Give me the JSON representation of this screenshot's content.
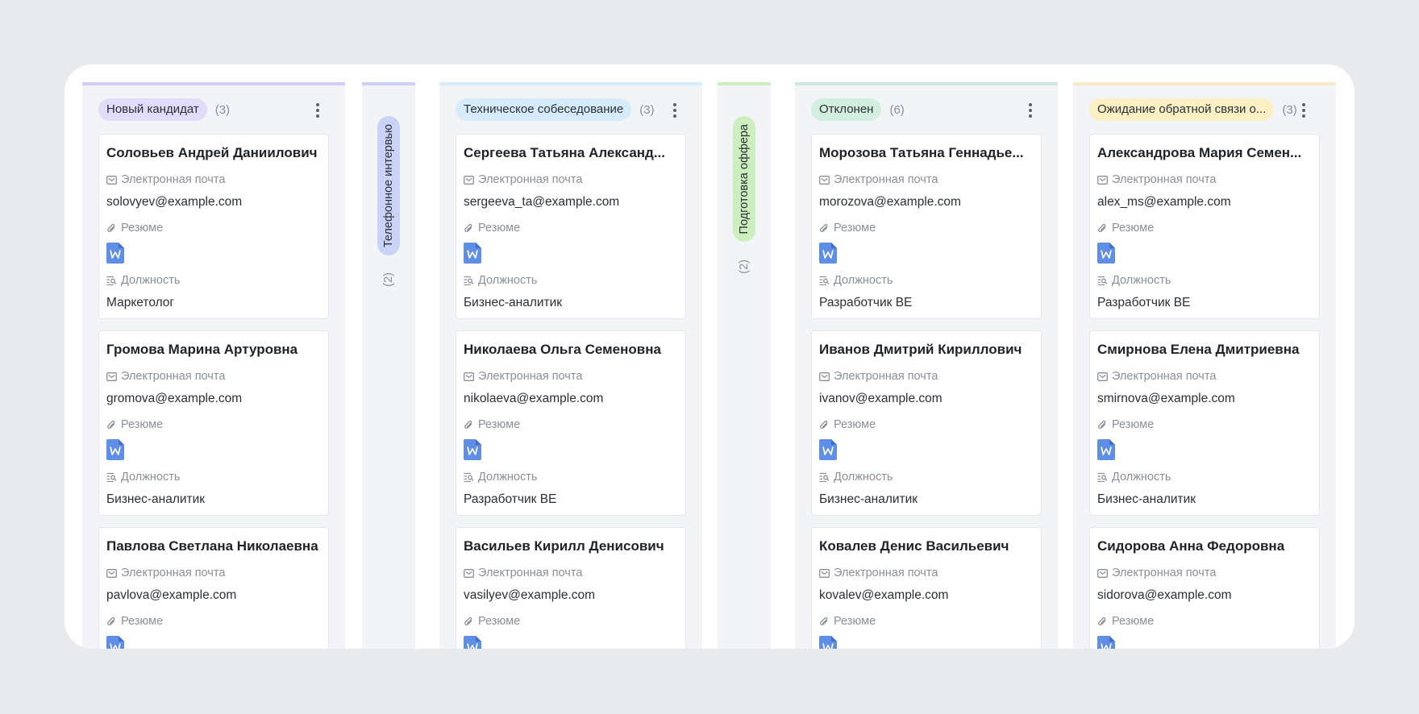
{
  "labels": {
    "email": "Электронная почта",
    "resume": "Резюме",
    "position": "Должность"
  },
  "columns": [
    {
      "title": "Новый кандидат",
      "count": "(3)",
      "tag_bg": "#e2dcfa",
      "top_color": "#d5cdf5",
      "cards": [
        {
          "name": "Соловьев Андрей Даниилович",
          "email": "solovyev@example.com",
          "position": "Маркетолог"
        },
        {
          "name": "Громова Марина Артуровна",
          "email": "gromova@example.com",
          "position": "Бизнес-аналитик"
        },
        {
          "name": "Павлова Светлана Николаевна",
          "email": "pavlova@example.com",
          "position": ""
        }
      ]
    },
    {
      "title": "Техническое собеседование",
      "count": "(3)",
      "tag_bg": "#d6ecfb",
      "top_color": "#d6ecfb",
      "cards": [
        {
          "name": "Сергеева Татьяна Александ...",
          "email": "sergeeva_ta@example.com",
          "position": "Бизнес-аналитик"
        },
        {
          "name": "Николаева Ольга Семеновна",
          "email": "nikolaeva@example.com",
          "position": "Разработчик BE"
        },
        {
          "name": "Васильев Кирилл Денисович",
          "email": "vasilyev@example.com",
          "position": ""
        }
      ]
    },
    {
      "title": "Отклонен",
      "count": "(6)",
      "tag_bg": "#d2eede",
      "top_color": "#cfe6dc",
      "cards": [
        {
          "name": "Морозова Татьяна Геннадье...",
          "email": "morozova@example.com",
          "position": "Разработчик BE"
        },
        {
          "name": "Иванов Дмитрий Кириллович",
          "email": "ivanov@example.com",
          "position": "Бизнес-аналитик"
        },
        {
          "name": "Ковалев Денис Васильевич",
          "email": "kovalev@example.com",
          "position": ""
        }
      ]
    },
    {
      "title": "Ожидание обратной связи о...",
      "count": "(3)",
      "tag_bg": "#fbefc4",
      "top_color": "#f6ebc6",
      "cards": [
        {
          "name": "Александрова Мария Семен...",
          "email": "alex_ms@example.com",
          "position": "Разработчик BE"
        },
        {
          "name": "Смирнова Елена Дмитриевна",
          "email": "smirnova@example.com",
          "position": "Бизнес-аналитик"
        },
        {
          "name": "Сидорова Анна Федоровна",
          "email": "sidorova@example.com",
          "position": ""
        }
      ]
    }
  ],
  "collapsed_columns": [
    {
      "title": "Телефонное интервью",
      "count": "(2)",
      "tag_bg": "#c9d3f6",
      "top_color": "#c9d3f6"
    },
    {
      "title": "Подготовка оффера",
      "count": "(2)",
      "tag_bg": "#cdeebf",
      "top_color": "#cdeebf"
    }
  ]
}
